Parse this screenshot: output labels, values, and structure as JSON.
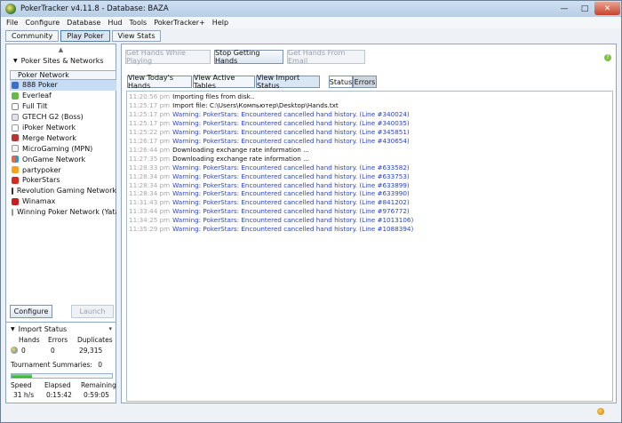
{
  "window": {
    "title": "PokerTracker v4.11.8 - Database: BAZA"
  },
  "menu": [
    "File",
    "Configure",
    "Database",
    "Hud",
    "Tools",
    "PokerTracker+",
    "Help"
  ],
  "tabs": [
    "Community",
    "Play Poker",
    "View Stats"
  ],
  "sidebar": {
    "section_title": "Poker Sites & Networks",
    "list_header": "Poker Network",
    "networks": [
      "888 Poker",
      "Everleaf",
      "Full Tilt",
      "GTECH G2 (Boss)",
      "iPoker Network",
      "Merge Network",
      "MicroGaming (MPN)",
      "OnGame Network",
      "partypoker",
      "PokerStars",
      "Revolution Gaming Network",
      "Winamax",
      "Winning Poker Network (Yatahay"
    ],
    "configure_label": "Configure",
    "launch_label": "Launch"
  },
  "import_status": {
    "title": "Import Status",
    "hands_label": "Hands",
    "errors_label": "Errors",
    "duplicates_label": "Duplicates",
    "hands": "0",
    "errors": "0",
    "duplicates": "29,315",
    "tournament_label": "Tournament Summaries:",
    "tournament_value": "0",
    "progress": 0.2,
    "speed_label": "Speed",
    "elapsed_label": "Elapsed",
    "remaining_label": "Remaining",
    "speed": "31 h/s",
    "elapsed": "0:15:42",
    "remaining": "0:59:05"
  },
  "toolbar": {
    "get_hands_playing": "Get Hands While Playing",
    "stop_getting": "Stop Getting Hands",
    "get_email": "Get Hands From Email"
  },
  "view_buttons": [
    "View Today's Hands",
    "View Active Tables",
    "View Import Status"
  ],
  "log_tabs": [
    "Status",
    "Errors"
  ],
  "log": [
    {
      "time": "11:20:56 pm",
      "msg": "Importing files from disk..",
      "kind": "info"
    },
    {
      "time": "11:25:17 pm",
      "msg": "Import file: C:\\Users\\Компьютер\\Desktop\\Hands.txt",
      "kind": "info"
    },
    {
      "time": "11:25:17 pm",
      "msg": "Warning: PokerStars: Encountered cancelled hand history. (Line #340024)",
      "kind": "warn"
    },
    {
      "time": "11:25:17 pm",
      "msg": "Warning: PokerStars: Encountered cancelled hand history. (Line #340035)",
      "kind": "warn"
    },
    {
      "time": "11:25:22 pm",
      "msg": "Warning: PokerStars: Encountered cancelled hand history. (Line #345851)",
      "kind": "warn"
    },
    {
      "time": "11:26:17 pm",
      "msg": "Warning: PokerStars: Encountered cancelled hand history. (Line #430654)",
      "kind": "warn"
    },
    {
      "time": "11:26:44 pm",
      "msg": "Downloading exchange rate information ...",
      "kind": "info"
    },
    {
      "time": "11:27:35 pm",
      "msg": "Downloading exchange rate information ...",
      "kind": "info"
    },
    {
      "time": "11:28:33 pm",
      "msg": "Warning: PokerStars: Encountered cancelled hand history. (Line #633582)",
      "kind": "warn"
    },
    {
      "time": "11:28:34 pm",
      "msg": "Warning: PokerStars: Encountered cancelled hand history. (Line #633753)",
      "kind": "warn"
    },
    {
      "time": "11:28:34 pm",
      "msg": "Warning: PokerStars: Encountered cancelled hand history. (Line #633899)",
      "kind": "warn"
    },
    {
      "time": "11:28:34 pm",
      "msg": "Warning: PokerStars: Encountered cancelled hand history. (Line #633990)",
      "kind": "warn"
    },
    {
      "time": "11:31:43 pm",
      "msg": "Warning: PokerStars: Encountered cancelled hand history. (Line #841202)",
      "kind": "warn"
    },
    {
      "time": "11:33:44 pm",
      "msg": "Warning: PokerStars: Encountered cancelled hand history. (Line #976772)",
      "kind": "warn"
    },
    {
      "time": "11:34:25 pm",
      "msg": "Warning: PokerStars: Encountered cancelled hand history. (Line #1013106)",
      "kind": "warn"
    },
    {
      "time": "11:35:29 pm",
      "msg": "Warning: PokerStars: Encountered cancelled hand history. (Line #1088394)",
      "kind": "warn"
    }
  ]
}
